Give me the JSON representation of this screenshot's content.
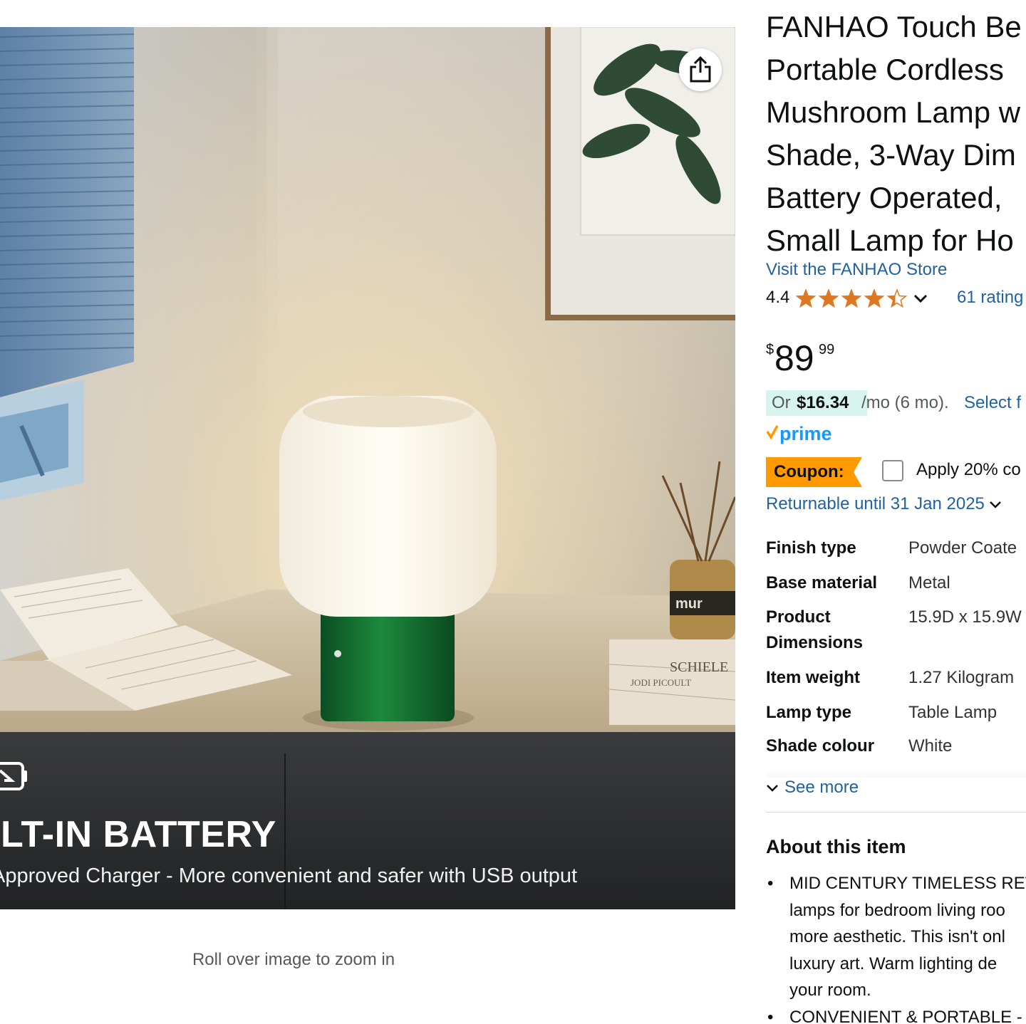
{
  "share": {
    "icon": "share-icon"
  },
  "image": {
    "banner_title": "ILT-IN BATTERY",
    "banner_subtitle": "Approved Charger - More convenient and safer with USB output",
    "lamp_brand_text": "mur",
    "book_spine_1": "SCHIELE",
    "book_spine_2": "JODI PICOULT",
    "zoom_hint": "Roll over image to zoom in"
  },
  "product": {
    "title_lines": [
      "FANHAO Touch Be",
      "Portable Cordless",
      "Mushroom Lamp w",
      "Shade, 3-Way Dim",
      "Battery Operated,",
      "Small Lamp for Ho"
    ],
    "store_link": "Visit the FANHAO Store",
    "rating": "4.4",
    "stars": 4.4,
    "rating_count": "61 rating",
    "price": {
      "symbol": "$",
      "whole": "89",
      "fraction": "99"
    },
    "installment": {
      "prefix": "Or",
      "amount": "$16.34",
      "suffix": "/mo (6 mo).",
      "link": "Select f"
    },
    "prime_label": "prime",
    "coupon": {
      "label": "Coupon:",
      "text": "Apply 20% co",
      "checked": false
    },
    "returnable": "Returnable until 31 Jan 2025"
  },
  "specs": [
    {
      "key": "Finish type",
      "value": "Powder Coate"
    },
    {
      "key": "Base material",
      "value": "Metal"
    },
    {
      "key_lines": [
        "Product",
        "Dimensions"
      ],
      "value": "15.9D x 15.9W"
    },
    {
      "key": "Item weight",
      "value": "1.27 Kilogram"
    },
    {
      "key": "Lamp type",
      "value": "Table Lamp"
    },
    {
      "key": "Shade colour",
      "value": "White"
    }
  ],
  "see_more": "See more",
  "about": {
    "title": "About this item",
    "bullets": [
      {
        "lines": [
          "MID CENTURY TIMELESS RET",
          "lamps for bedroom living roo",
          "more aesthetic. This isn't onl",
          "luxury art. Warm lighting de",
          "your room."
        ]
      },
      {
        "lines": [
          "CONVENIENT & PORTABLE -"
        ]
      }
    ]
  },
  "colors": {
    "link": "#2162a1",
    "coupon": "#ff9900",
    "star": "#de7921",
    "prime": "#1399ff",
    "installment_bg": "#d7f4ee"
  }
}
